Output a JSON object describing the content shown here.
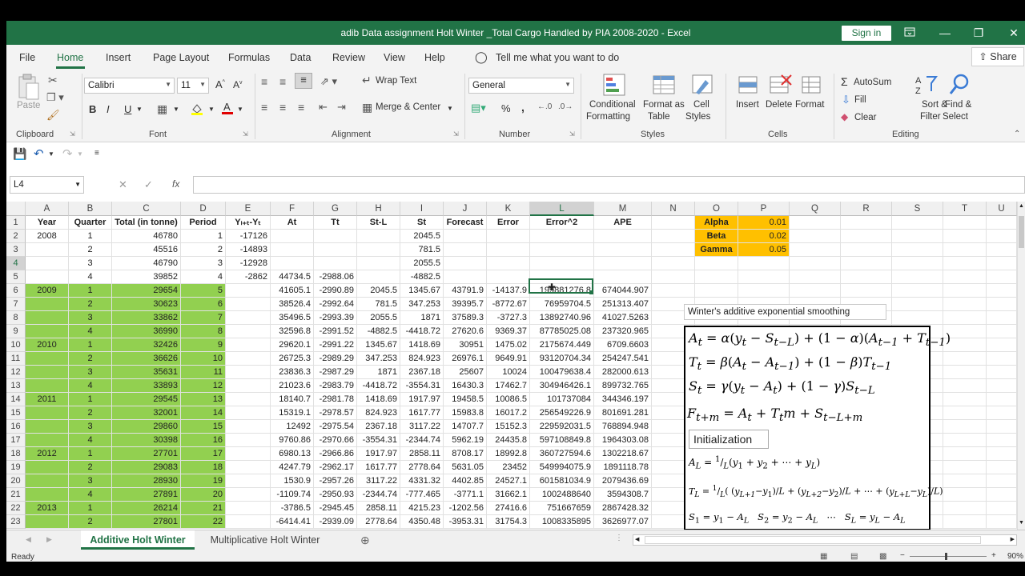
{
  "window": {
    "title": "adib Data assignment Holt Winter _Total Cargo Handled by PIA 2008-2020  -  Excel",
    "sign_in": "Sign in"
  },
  "menu": {
    "items": [
      "File",
      "Home",
      "Insert",
      "Page Layout",
      "Formulas",
      "Data",
      "Review",
      "View",
      "Help"
    ],
    "tell_me": "Tell me what you want to do",
    "share": "Share"
  },
  "ribbon": {
    "clipboard": {
      "paste": "Paste",
      "label": "Clipboard"
    },
    "font": {
      "name": "Calibri",
      "size": "11",
      "label": "Font",
      "bold": "B",
      "italic": "I",
      "underline": "U"
    },
    "alignment": {
      "wrap": "Wrap Text",
      "merge": "Merge & Center",
      "label": "Alignment"
    },
    "number": {
      "format": "General",
      "label": "Number",
      "percent": "%",
      "comma": ","
    },
    "styles": {
      "conditional": "Conditional",
      "conditional2": "Formatting",
      "format_table": "Format as",
      "format_table2": "Table",
      "cell_styles": "Cell",
      "cell_styles2": "Styles",
      "label": "Styles"
    },
    "cells": {
      "insert": "Insert",
      "delete": "Delete",
      "format": "Format",
      "label": "Cells"
    },
    "editing": {
      "autosum": "AutoSum",
      "fill": "Fill",
      "clear": "Clear",
      "sort": "Sort &",
      "sort2": "Filter",
      "find": "Find &",
      "find2": "Select",
      "label": "Editing"
    }
  },
  "formula_bar": {
    "name_box": "L4",
    "fx": "fx"
  },
  "columns": [
    "A",
    "B",
    "C",
    "D",
    "E",
    "F",
    "G",
    "H",
    "I",
    "J",
    "K",
    "L",
    "M",
    "N",
    "O",
    "P",
    "Q",
    "R",
    "S",
    "T",
    "U"
  ],
  "headers": [
    "Year",
    "Quarter",
    "Total (in tonne)",
    "Period",
    "Yₗ₊ₜ-Yₜ",
    "At",
    "Tt",
    "St-L",
    "St",
    "Forecast",
    "Error",
    "Error^2",
    "APE"
  ],
  "rows": [
    [
      "2008",
      "1",
      "46780",
      "1",
      "-17126",
      "",
      "",
      "",
      "2045.5",
      "",
      "",
      "",
      ""
    ],
    [
      "",
      "2",
      "45516",
      "2",
      "-14893",
      "",
      "",
      "",
      "781.5",
      "",
      "",
      "",
      ""
    ],
    [
      "",
      "3",
      "46790",
      "3",
      "-12928",
      "",
      "",
      "",
      "2055.5",
      "",
      "",
      "",
      ""
    ],
    [
      "",
      "4",
      "39852",
      "4",
      "-2862",
      "44734.5",
      "-2988.06",
      "",
      "-4882.5",
      "",
      "",
      "",
      ""
    ],
    [
      "2009",
      "1",
      "29654",
      "5",
      "",
      "41605.1",
      "-2990.89",
      "2045.5",
      "1345.67",
      "43791.9",
      "-14137.9",
      "199881276.8",
      "674044.907"
    ],
    [
      "",
      "2",
      "30623",
      "6",
      "",
      "38526.4",
      "-2992.64",
      "781.5",
      "347.253",
      "39395.7",
      "-8772.67",
      "76959704.5",
      "251313.407"
    ],
    [
      "",
      "3",
      "33862",
      "7",
      "",
      "35496.5",
      "-2993.39",
      "2055.5",
      "1871",
      "37589.3",
      "-3727.3",
      "13892740.96",
      "41027.5263"
    ],
    [
      "",
      "4",
      "36990",
      "8",
      "",
      "32596.8",
      "-2991.52",
      "-4882.5",
      "-4418.72",
      "27620.6",
      "9369.37",
      "87785025.08",
      "237320.965"
    ],
    [
      "2010",
      "1",
      "32426",
      "9",
      "",
      "29620.1",
      "-2991.22",
      "1345.67",
      "1418.69",
      "30951",
      "1475.02",
      "2175674.449",
      "6709.6603"
    ],
    [
      "",
      "2",
      "36626",
      "10",
      "",
      "26725.3",
      "-2989.29",
      "347.253",
      "824.923",
      "26976.1",
      "9649.91",
      "93120704.34",
      "254247.541"
    ],
    [
      "",
      "3",
      "35631",
      "11",
      "",
      "23836.3",
      "-2987.29",
      "1871",
      "2367.18",
      "25607",
      "10024",
      "100479638.4",
      "282000.613"
    ],
    [
      "",
      "4",
      "33893",
      "12",
      "",
      "21023.6",
      "-2983.79",
      "-4418.72",
      "-3554.31",
      "16430.3",
      "17462.7",
      "304946426.1",
      "899732.765"
    ],
    [
      "2011",
      "1",
      "29545",
      "13",
      "",
      "18140.7",
      "-2981.78",
      "1418.69",
      "1917.97",
      "19458.5",
      "10086.5",
      "101737084",
      "344346.197"
    ],
    [
      "",
      "2",
      "32001",
      "14",
      "",
      "15319.1",
      "-2978.57",
      "824.923",
      "1617.77",
      "15983.8",
      "16017.2",
      "256549226.9",
      "801691.281"
    ],
    [
      "",
      "3",
      "29860",
      "15",
      "",
      "12492",
      "-2975.54",
      "2367.18",
      "3117.22",
      "14707.7",
      "15152.3",
      "229592031.5",
      "768894.948"
    ],
    [
      "",
      "4",
      "30398",
      "16",
      "",
      "9760.86",
      "-2970.66",
      "-3554.31",
      "-2344.74",
      "5962.19",
      "24435.8",
      "597108849.8",
      "1964303.08"
    ],
    [
      "2012",
      "1",
      "27701",
      "17",
      "",
      "6980.13",
      "-2966.86",
      "1917.97",
      "2858.11",
      "8708.17",
      "18992.8",
      "360727594.6",
      "1302218.67"
    ],
    [
      "",
      "2",
      "29083",
      "18",
      "",
      "4247.79",
      "-2962.17",
      "1617.77",
      "2778.64",
      "5631.05",
      "23452",
      "549994075.9",
      "1891118.78"
    ],
    [
      "",
      "3",
      "28930",
      "19",
      "",
      "1530.9",
      "-2957.26",
      "3117.22",
      "4331.32",
      "4402.85",
      "24527.1",
      "601581034.9",
      "2079436.69"
    ],
    [
      "",
      "4",
      "27891",
      "20",
      "",
      "-1109.74",
      "-2950.93",
      "-2344.74",
      "-777.465",
      "-3771.1",
      "31662.1",
      "1002488640",
      "3594308.7"
    ],
    [
      "2013",
      "1",
      "26214",
      "21",
      "",
      "-3786.5",
      "-2945.45",
      "2858.11",
      "4215.23",
      "-1202.56",
      "27416.6",
      "751667659",
      "2867428.32"
    ],
    [
      "",
      "2",
      "27801",
      "22",
      "",
      "-6414.41",
      "-2939.09",
      "2778.64",
      "4350.48",
      "-3953.31",
      "31754.3",
      "1008335895",
      "3626977.07"
    ]
  ],
  "params": [
    [
      "Alpha",
      "0.01"
    ],
    [
      "Beta",
      "0.02"
    ],
    [
      "Gamma",
      "0.05"
    ]
  ],
  "formula_panel": {
    "caption": "Winter's additive exponential smoothing",
    "initialization": "Initialization"
  },
  "sheets": [
    "Additive Holt Winter",
    "Multiplicative Holt Winter"
  ],
  "status": {
    "ready": "Ready",
    "zoom": "90%"
  }
}
